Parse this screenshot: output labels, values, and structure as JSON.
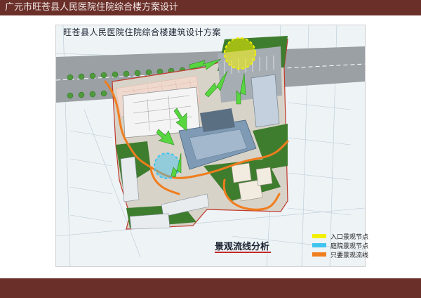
{
  "header": {
    "title": "广元市旺苍县人民医院住院综合楼方案设计"
  },
  "plan": {
    "title": "旺苍县人民医院住院综合楼建筑设计方案"
  },
  "section": {
    "title": "景观流线分析"
  },
  "legend": {
    "items": [
      {
        "label": "入口景观节点",
        "color": "#f2f000"
      },
      {
        "label": "庭院景观节点",
        "color": "#3fc4f0"
      },
      {
        "label": "只要景观流线",
        "color": "#f07d1e"
      }
    ]
  },
  "colors": {
    "brand_bar": "#6b2f2a",
    "entrance_node": "#f2f000",
    "courtyard_node": "#3fc4f0",
    "flow_line": "#f07d1e",
    "green_arrow": "#58d640",
    "site_boundary": "#c0392b"
  }
}
